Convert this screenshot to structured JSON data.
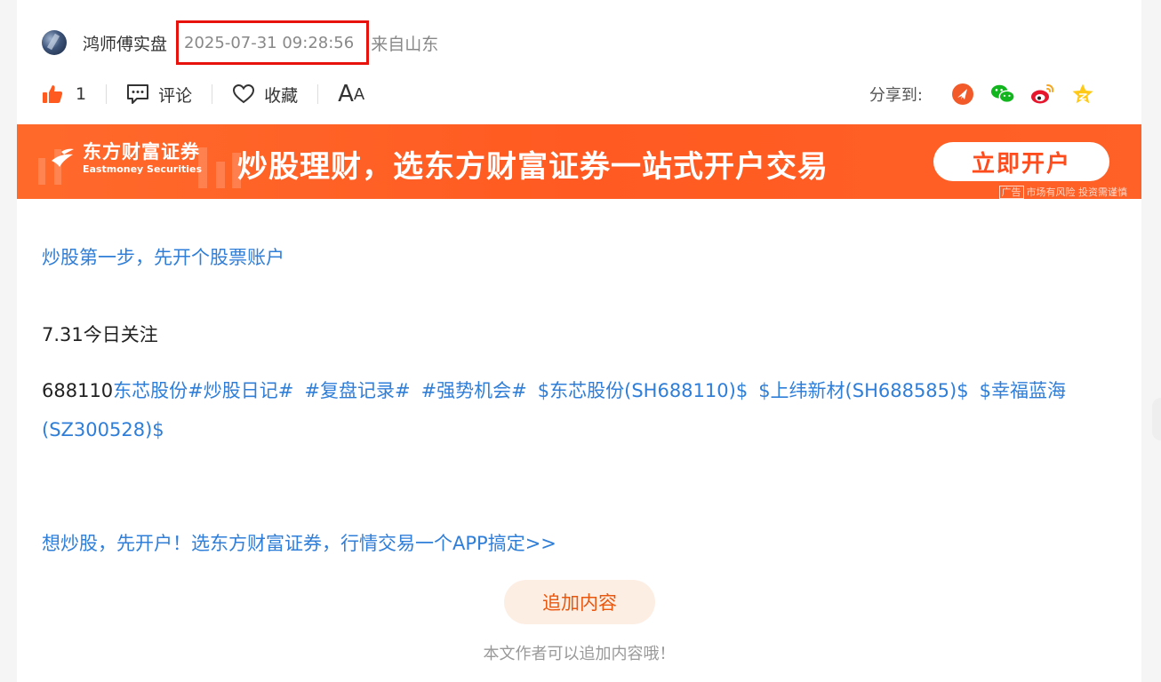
{
  "author": {
    "name": "鸿师傅实盘",
    "timestamp": "2025-07-31 09:28:56",
    "location": "来自山东"
  },
  "actions": {
    "like_count": "1",
    "comment_label": "评论",
    "favorite_label": "收藏",
    "font_big": "A",
    "font_small": "A"
  },
  "share": {
    "label": "分享到:",
    "targets": [
      "weibo-toutiao",
      "wechat",
      "weibo",
      "favorite-star"
    ]
  },
  "banner": {
    "brand_cn": "东方财富证券",
    "brand_en": "Eastmoney Securities",
    "slogan": "炒股理财，选东方财富证券一站式开户交易",
    "button": "立即开户",
    "ad_tag": "广告",
    "ad_note": "市场有风险 投资需谨慎"
  },
  "content": {
    "promo_top": "炒股第一步，先开个股票账户",
    "date_heading": "7.31今日关注",
    "code": "688110",
    "stock_name": "东芯股份",
    "hashtags": [
      "#炒股日记#",
      "#复盘记录#",
      "#强势机会#"
    ],
    "stocks": [
      "$东芯股份(SH688110)$",
      "$上纬新材(SH688585)$",
      "$幸福蓝海(SZ300528)$"
    ],
    "promo_bottom": "想炒股，先开户！选东方财富证券，行情交易一个APP搞定>>"
  },
  "append": {
    "button": "追加内容",
    "note": "本文作者可以追加内容哦！"
  },
  "colors": {
    "link": "#2f7ed8",
    "accent": "#ff5a21",
    "highlight_box": "#e8120c",
    "append_text": "#e9570f"
  }
}
